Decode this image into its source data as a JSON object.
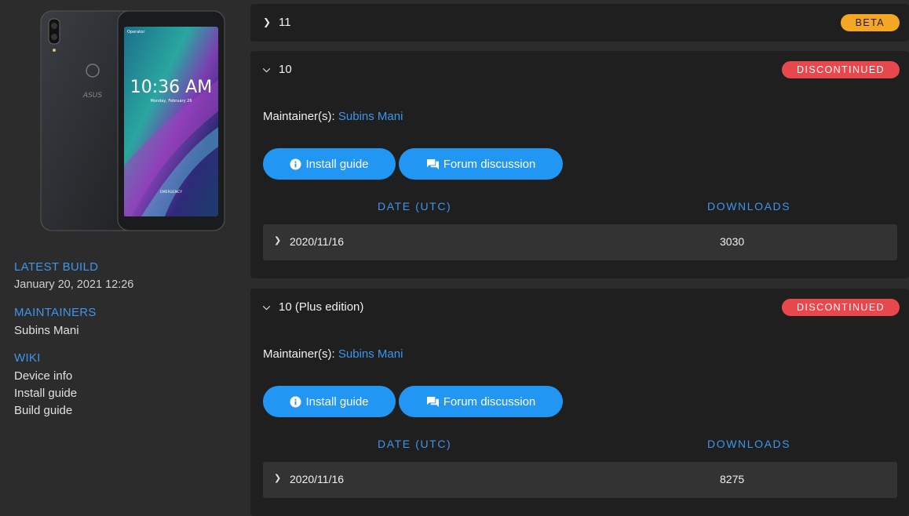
{
  "sidebar": {
    "latest_build_heading": "LATEST BUILD",
    "latest_build_value": "January 20, 2021 12:26",
    "maintainers_heading": "MAINTAINERS",
    "maintainers_value": "Subins Mani",
    "wiki_heading": "WIKI",
    "wiki_links": [
      "Device info",
      "Install guide",
      "Build guide"
    ],
    "device_image": {
      "brand_text": "ASUS",
      "operator_text": "Operator",
      "clock": "10:36 AM",
      "date": "Monday, February 26",
      "emergency": "EMERGENCY"
    }
  },
  "versions": [
    {
      "title": "11",
      "badge": "BETA",
      "badge_kind": "beta",
      "expanded": false
    },
    {
      "title": "10",
      "badge": "DISCONTINUED",
      "badge_kind": "discontinued",
      "expanded": true,
      "maintainer_label": "Maintainer(s):",
      "maintainer_name": "Subins Mani",
      "install_label": "Install guide",
      "forum_label": "Forum discussion",
      "col_date": "DATE (UTC)",
      "col_downloads": "DOWNLOADS",
      "builds": [
        {
          "date": "2020/11/16",
          "downloads": "3030"
        }
      ]
    },
    {
      "title": "10 (Plus edition)",
      "badge": "DISCONTINUED",
      "badge_kind": "discontinued",
      "expanded": true,
      "maintainer_label": "Maintainer(s):",
      "maintainer_name": "Subins Mani",
      "install_label": "Install guide",
      "forum_label": "Forum discussion",
      "col_date": "DATE (UTC)",
      "col_downloads": "DOWNLOADS",
      "builds": [
        {
          "date": "2020/11/16",
          "downloads": "8275"
        }
      ]
    }
  ],
  "colors": {
    "accent": "#3d95ec",
    "button": "#2196f3",
    "beta": "#f5a623",
    "discontinued": "#e8484c",
    "card": "#1f1f1f",
    "page": "#2c2c2c"
  }
}
